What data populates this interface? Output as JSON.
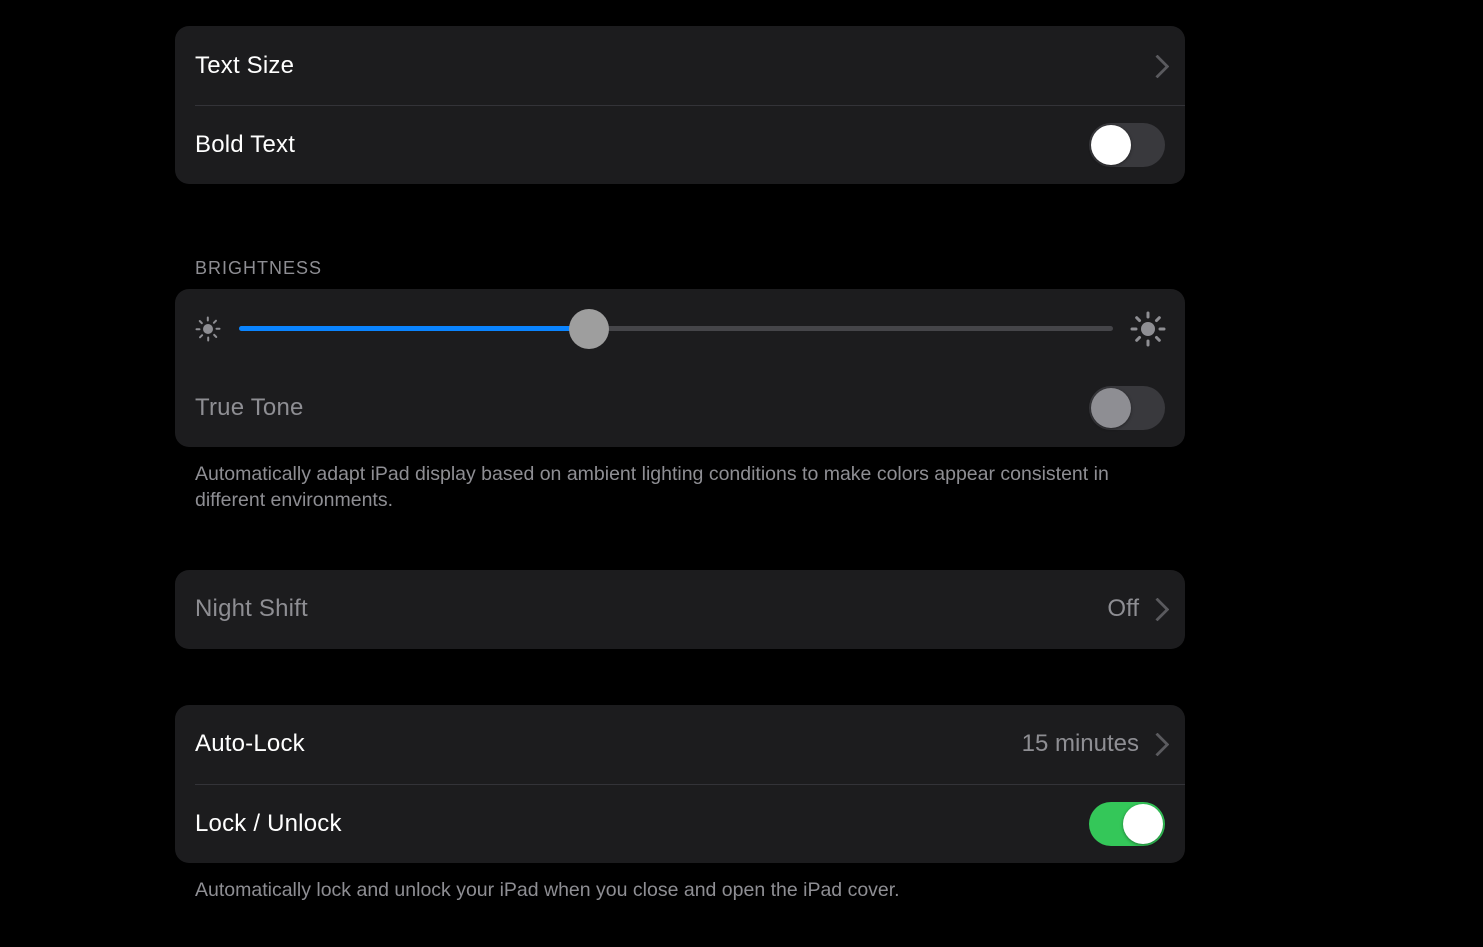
{
  "text_group": {
    "text_size_label": "Text Size",
    "bold_text_label": "Bold Text",
    "bold_text_on": false
  },
  "brightness": {
    "header": "BRIGHTNESS",
    "value_percent": 40,
    "true_tone_label": "True Tone",
    "true_tone_on": false,
    "footer": "Automatically adapt iPad display based on ambient lighting conditions to make colors appear consistent in different environments."
  },
  "night_shift": {
    "label": "Night Shift",
    "value": "Off"
  },
  "lock": {
    "auto_lock_label": "Auto-Lock",
    "auto_lock_value": "15 minutes",
    "lock_unlock_label": "Lock / Unlock",
    "lock_unlock_on": true,
    "footer": "Automatically lock and unlock your iPad when you close and open the iPad cover."
  },
  "colors": {
    "accent_blue": "#0a84ff",
    "toggle_green": "#34c759",
    "cell_bg": "#1c1c1e",
    "secondary_text": "#8e8e93"
  }
}
